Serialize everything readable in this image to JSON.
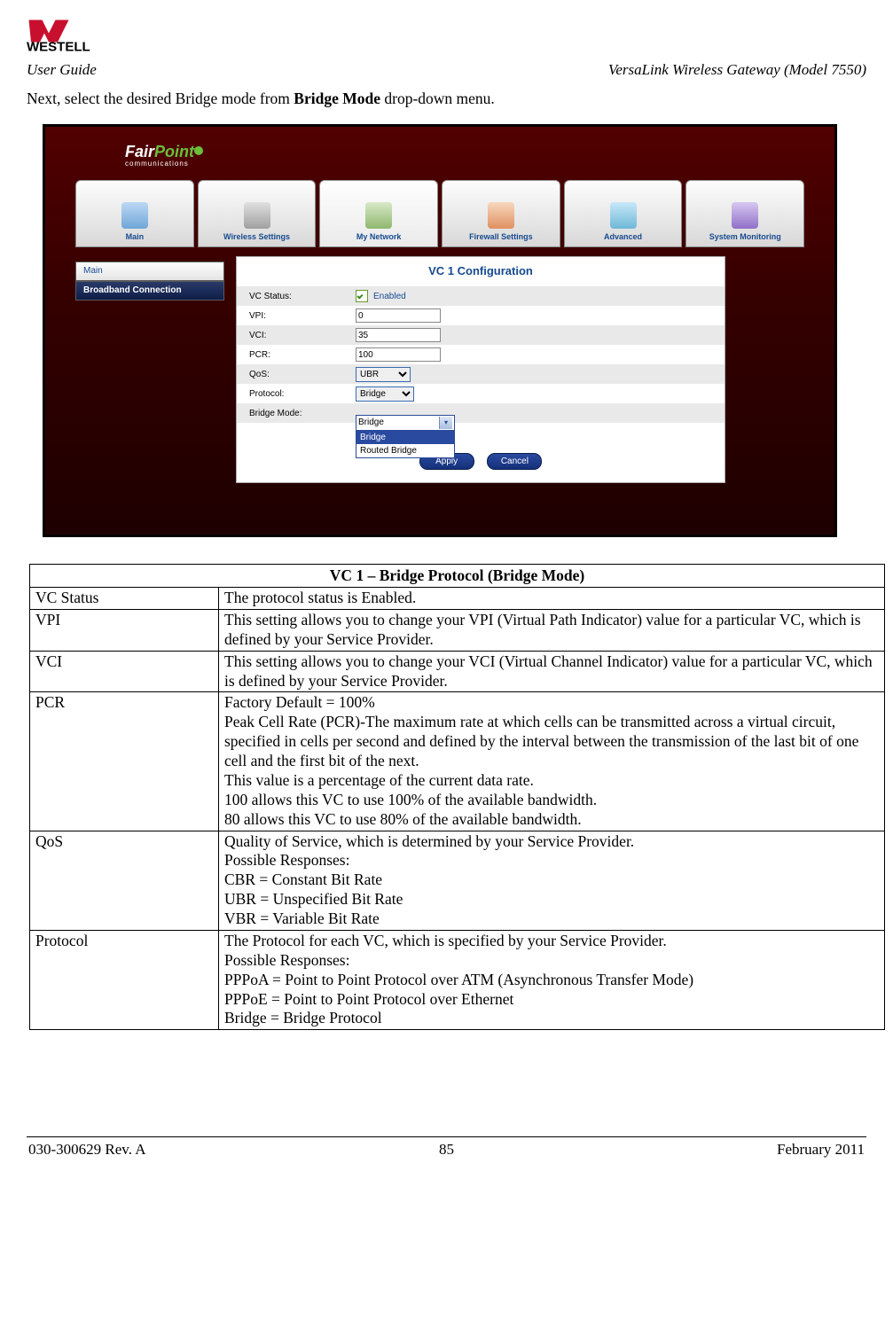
{
  "brand": "WESTELL",
  "header": {
    "left": "User Guide",
    "right": "VersaLink Wireless Gateway (Model 7550)"
  },
  "intro": {
    "pre": "Next, select the desired Bridge mode from ",
    "bold": "Bridge Mode",
    "post": " drop-down menu."
  },
  "router": {
    "logo_main": "FairPoint",
    "logo_sub": "communications",
    "tabs": [
      {
        "label": "Main"
      },
      {
        "label": "Wireless Settings"
      },
      {
        "label": "My Network"
      },
      {
        "label": "Firewall Settings"
      },
      {
        "label": "Advanced"
      },
      {
        "label": "System Monitoring"
      }
    ],
    "sidebar": {
      "main": "Main",
      "bb": "Broadband Connection"
    },
    "panel_title": "VC 1 Configuration",
    "rows": {
      "vc_status_label": "VC Status:",
      "enabled": "Enabled",
      "vpi_label": "VPI:",
      "vpi_value": "0",
      "vci_label": "VCI:",
      "vci_value": "35",
      "pcr_label": "PCR:",
      "pcr_value": "100",
      "qos_label": "QoS:",
      "qos_value": "UBR",
      "proto_label": "Protocol:",
      "proto_value": "Bridge",
      "bm_label": "Bridge Mode:",
      "bm_selected": "Bridge",
      "bm_opt1": "Bridge",
      "bm_opt2": "Routed Bridge"
    },
    "buttons": {
      "apply": "Apply",
      "cancel": "Cancel"
    }
  },
  "table": {
    "title": "VC 1 – Bridge Protocol (Bridge Mode)",
    "rows": [
      {
        "k": "VC Status",
        "v": "The protocol status is Enabled."
      },
      {
        "k": "VPI",
        "v": "This setting allows you to change your VPI (Virtual Path Indicator) value for a particular VC, which is defined by your Service Provider."
      },
      {
        "k": "VCI",
        "v": "This setting allows you to change your VCI (Virtual Channel Indicator) value for a particular VC, which is defined by your Service Provider."
      },
      {
        "k": "PCR",
        "v": "Factory Default = 100%\nPeak Cell Rate (PCR)-The maximum rate at which cells can be transmitted across a virtual circuit, specified in cells per second and defined by the interval between the transmission of the last bit of one cell and the first bit of the next.\nThis value is a percentage of the current data rate.\n100 allows this VC to use 100% of the available bandwidth.\n80 allows this VC to use 80% of the available bandwidth."
      },
      {
        "k": "QoS",
        "v": "Quality of Service, which is determined by your Service Provider.\nPossible Responses:\nCBR = Constant Bit Rate\nUBR = Unspecified Bit Rate\nVBR = Variable Bit Rate"
      },
      {
        "k": "Protocol",
        "v": "The Protocol for each VC, which is specified by your Service Provider.\nPossible Responses:\nPPPoA = Point to Point Protocol over ATM (Asynchronous Transfer Mode)\nPPPoE = Point to Point Protocol over Ethernet\nBridge = Bridge Protocol"
      }
    ]
  },
  "footer": {
    "left": "030-300629 Rev. A",
    "center": "85",
    "right": "February 2011"
  }
}
